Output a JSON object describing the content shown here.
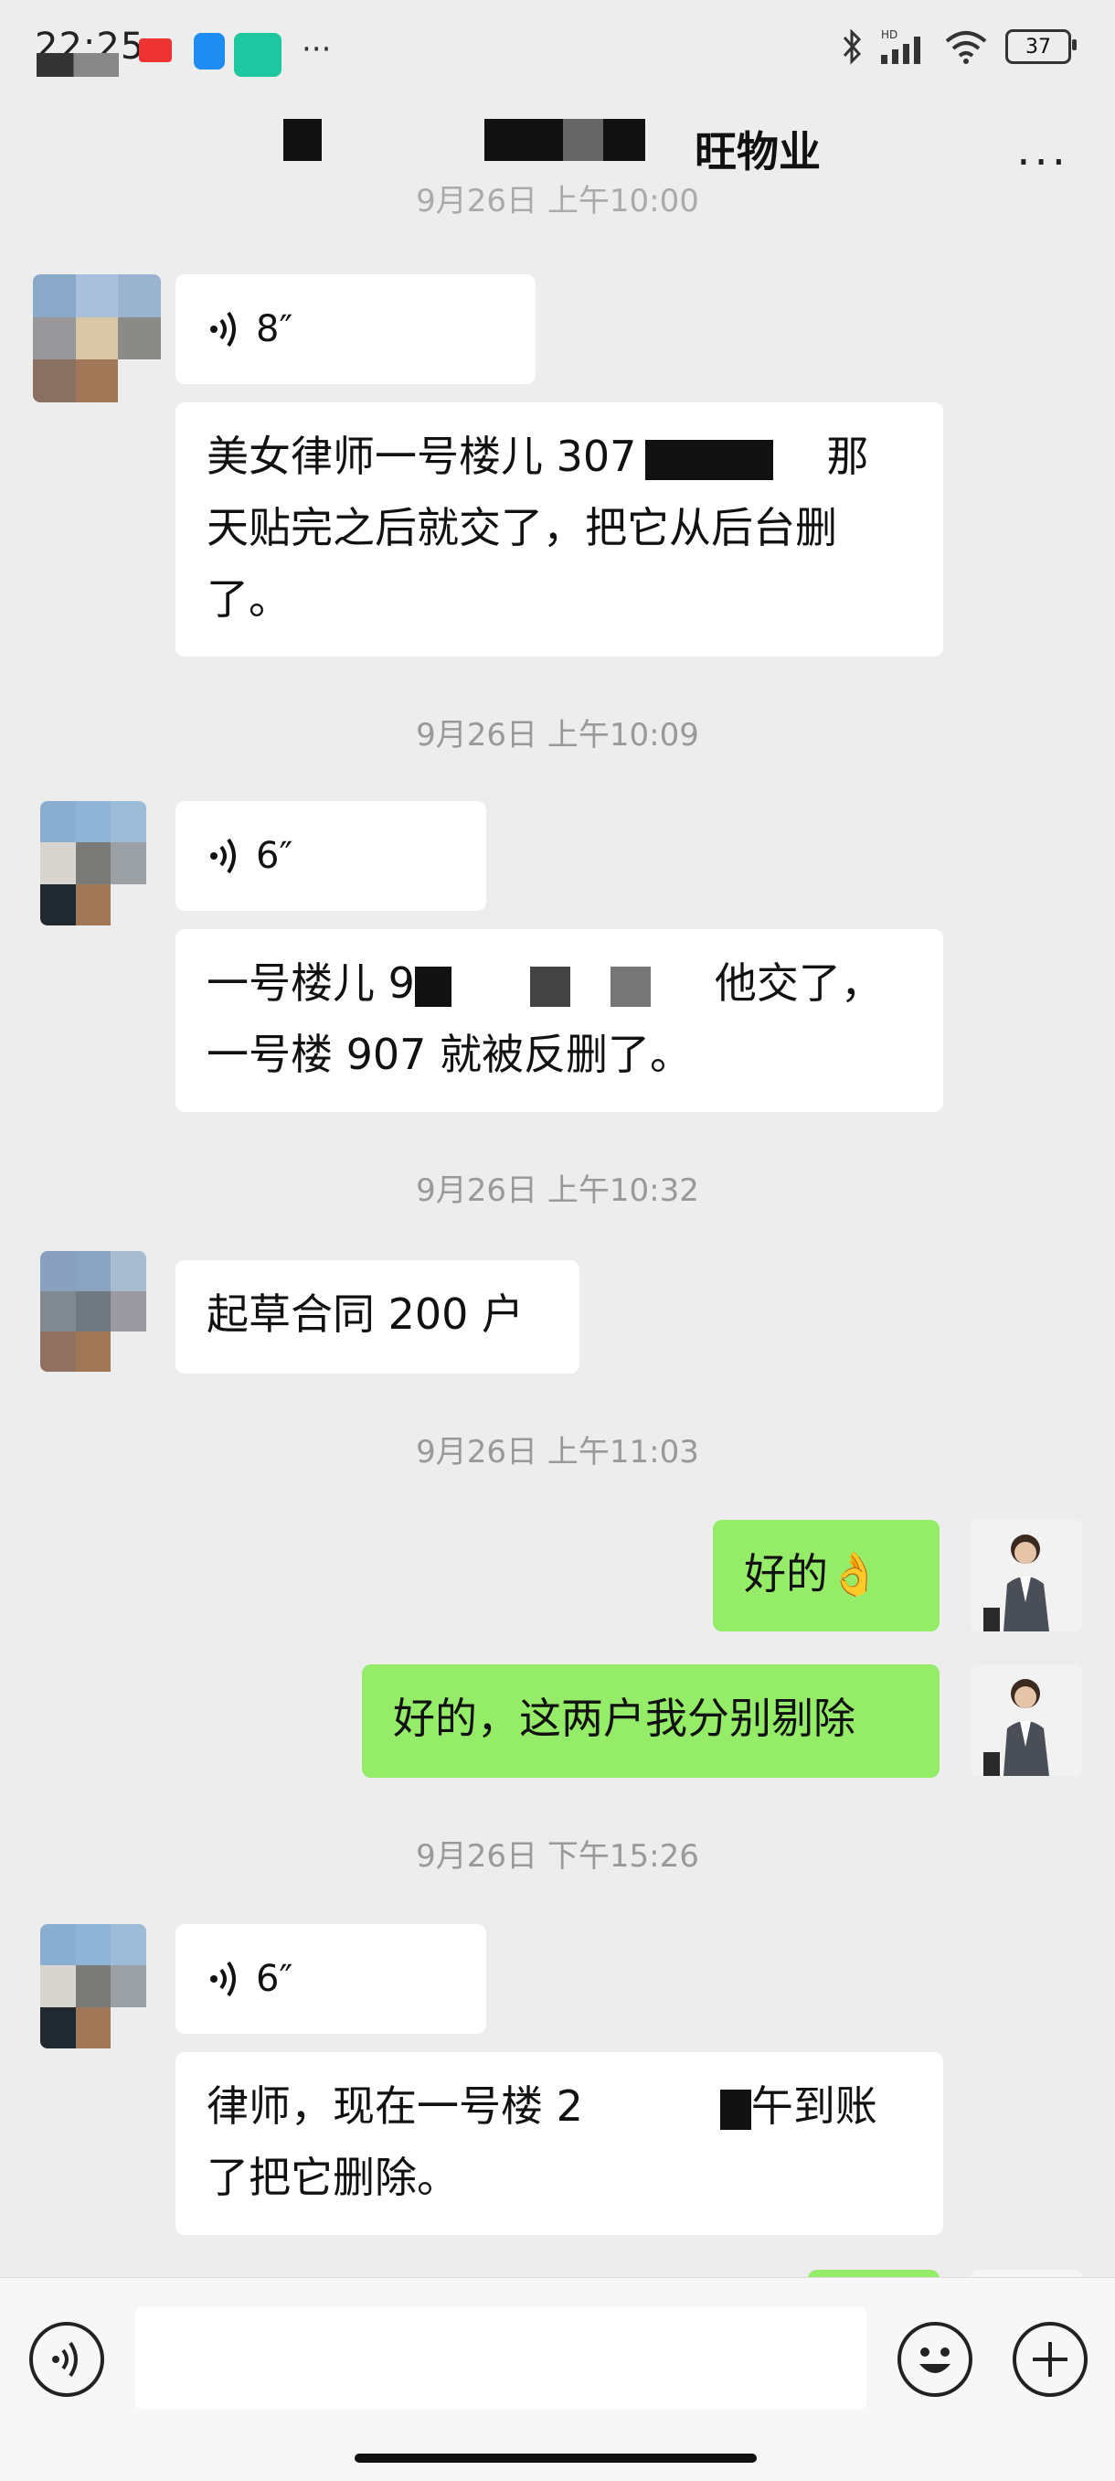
{
  "status_bar": {
    "time": "22:25",
    "battery": "37",
    "hd_label": "HD"
  },
  "header": {
    "title": "旺物业",
    "more": "···"
  },
  "messages": {
    "partial_time": "9月26日 上午10:00",
    "voice1_duration": "8″",
    "text1_line1_a": "美女律师一号楼儿 307",
    "text1_line1_b": "那",
    "text1_line2": "天贴完之后就交了，把它从后台删",
    "text1_line3": "了。",
    "time2": "9月26日 上午10:09",
    "voice2_duration": "6″",
    "text2_line1_a": "一号楼儿 9",
    "text2_line1_b": "他交了，",
    "text2_line2": "一号楼 907 就被反删了。",
    "time3": "9月26日 上午10:32",
    "text3": "起草合同 200 户",
    "time4": "9月26日 上午11:03",
    "reply1": "好的👌",
    "reply2": "好的，这两户我分别剔除",
    "time5": "9月26日 下午15:26",
    "voice3_duration": "6″",
    "text4_line1_a": "律师，现在一号楼 2",
    "text4_line1_b": "午到账",
    "text4_line2": "了把它删除。"
  },
  "colors": {
    "background": "#ededed",
    "bubble_in": "#ffffff",
    "bubble_out": "#95ec69",
    "timestamp": "#999999"
  },
  "icons": {
    "voice_input": "voice-input-icon",
    "emoji": "emoji-icon",
    "plus": "plus-icon",
    "more": "more-icon"
  }
}
